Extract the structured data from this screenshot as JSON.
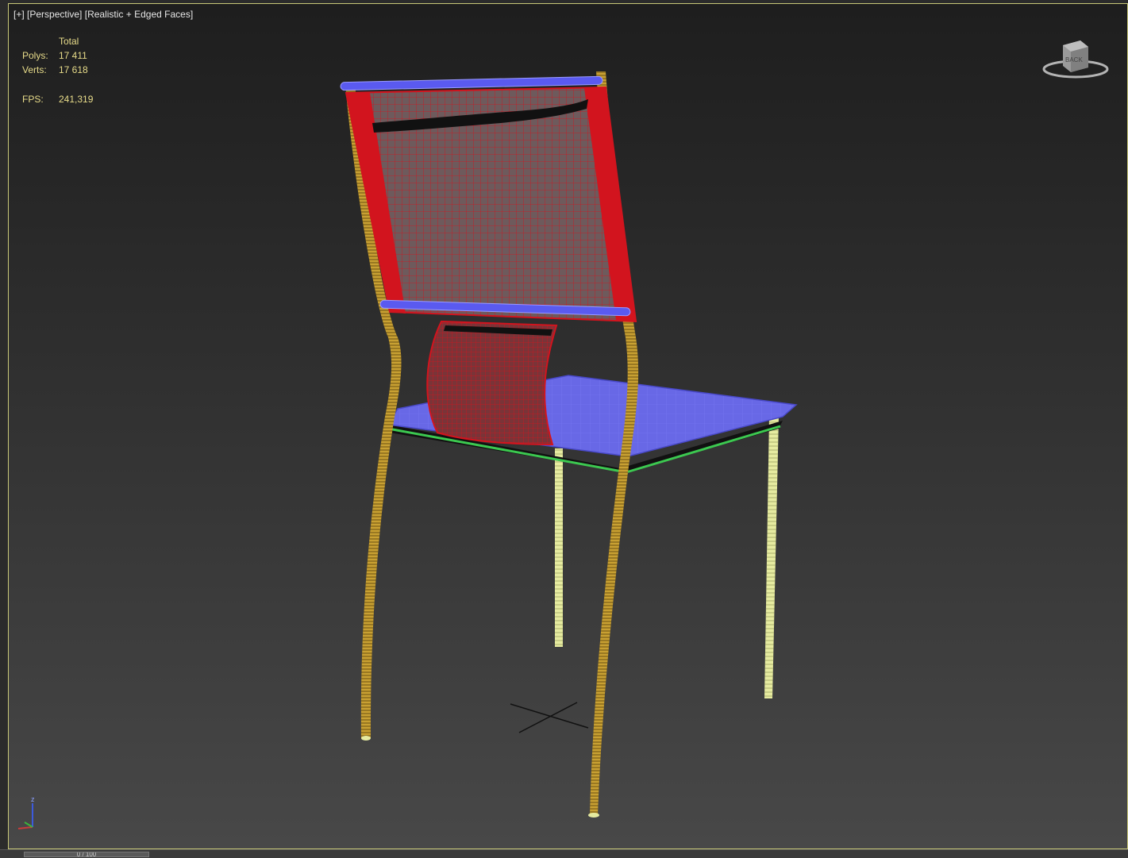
{
  "viewport": {
    "label_plus": "[+]",
    "label_view": "[Perspective]",
    "label_shading": "[Realistic + Edged Faces]"
  },
  "stats": {
    "header": "Total",
    "polys_label": "Polys:",
    "polys_value": "17 411",
    "verts_label": "Verts:",
    "verts_value": "17 618",
    "fps_label": "FPS:",
    "fps_value": "241,319"
  },
  "timeline": {
    "slider_text": "0 / 100"
  },
  "colors": {
    "wire_red": "#d2141e",
    "wire_blue": "#5a5af0",
    "wire_yellow": "#c8a032",
    "wire_cream": "#e6eba0",
    "wire_green": "#3cc850",
    "stats_text": "#e8dc8a"
  },
  "icons": {
    "viewcube": "viewcube-icon",
    "axis": "axis-tripod-icon",
    "pivot": "pivot-cross-icon"
  }
}
